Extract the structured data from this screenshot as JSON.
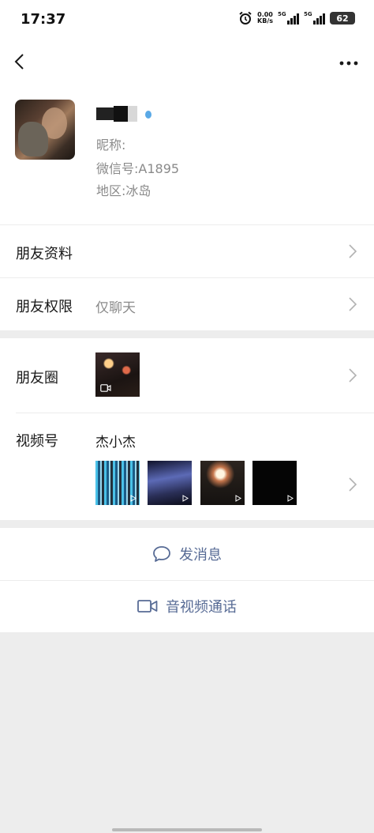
{
  "status_bar": {
    "time": "17:37",
    "net_speed_value": "0.00",
    "net_speed_unit": "KB/s",
    "signal1_label": "5G",
    "signal2_label": "5G",
    "battery": "62"
  },
  "profile": {
    "nickname_label": "昵称:",
    "wechat_id_label": "微信号:",
    "wechat_id_value": "A1895",
    "region_label": "地区:",
    "region_value": "冰岛"
  },
  "rows": {
    "friend_info": "朋友资料",
    "friend_permission": "朋友权限",
    "friend_permission_value": "仅聊天",
    "moments": "朋友圈",
    "channels": "视频号",
    "channel_name": "杰小杰"
  },
  "actions": {
    "send_message": "发消息",
    "av_call": "音视频通话"
  },
  "colors": {
    "link": "#576b95",
    "background": "#ededed"
  }
}
